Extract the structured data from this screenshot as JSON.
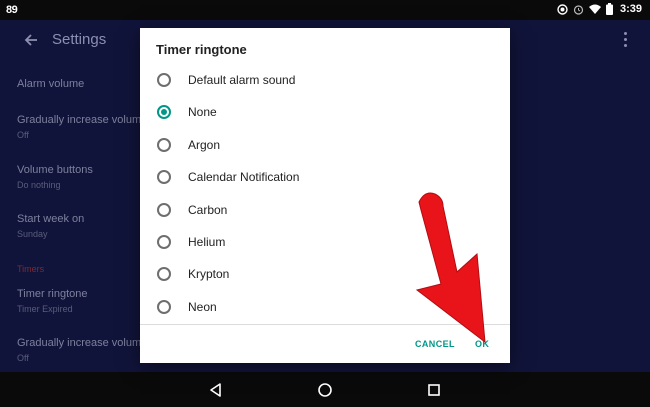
{
  "status_bar": {
    "left_badge": "89",
    "time": "3:39",
    "icons": [
      "alarm-status-icon",
      "alarm-clock-icon",
      "wifi-icon",
      "battery-icon"
    ]
  },
  "app": {
    "title": "Settings",
    "items": [
      {
        "title": "Alarm volume",
        "subtitle": ""
      },
      {
        "title": "Gradually increase volume",
        "subtitle": "Off"
      },
      {
        "title": "Volume buttons",
        "subtitle": "Do nothing"
      },
      {
        "title": "Start week on",
        "subtitle": "Sunday"
      },
      {
        "title": "Timer ringtone",
        "subtitle": "Timer Expired"
      },
      {
        "title": "Gradually increase volume",
        "subtitle": "Off"
      }
    ],
    "section_timers": "Timers"
  },
  "dialog": {
    "title": "Timer ringtone",
    "options": [
      {
        "label": "Default alarm sound",
        "checked": false
      },
      {
        "label": "None",
        "checked": true
      },
      {
        "label": "Argon",
        "checked": false
      },
      {
        "label": "Calendar Notification",
        "checked": false
      },
      {
        "label": "Carbon",
        "checked": false
      },
      {
        "label": "Helium",
        "checked": false
      },
      {
        "label": "Krypton",
        "checked": false
      },
      {
        "label": "Neon",
        "checked": false
      }
    ],
    "cancel_label": "CANCEL",
    "ok_label": "OK"
  },
  "colors": {
    "accent": "#009688",
    "annotation_arrow": "#e8141a",
    "app_background_dimmed": "#11143a"
  }
}
